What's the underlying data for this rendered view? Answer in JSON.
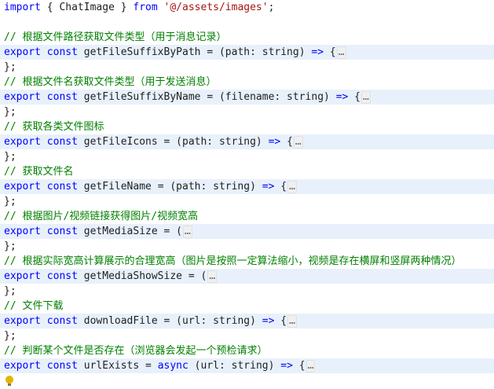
{
  "lines": [
    {
      "type": "import",
      "kw": "import",
      "open": "{",
      "name": "ChatImage",
      "close": "}",
      "from": "from",
      "path": "'@/assets/images'",
      "semi": ";"
    },
    {
      "type": "blank"
    },
    {
      "type": "comment",
      "text": "// 根据文件路径获取文件类型（用于消息记录）"
    },
    {
      "type": "fn",
      "export": "export",
      "const": "const",
      "name": "getFileSuffixByPath",
      "eq": "=",
      "params": "(path: string)",
      "arrow": "=>",
      "brace": "{",
      "ellipsis": "…"
    },
    {
      "type": "close",
      "text": "};"
    },
    {
      "type": "comment",
      "text": "// 根据文件名获取文件类型（用于发送消息）"
    },
    {
      "type": "fn",
      "export": "export",
      "const": "const",
      "name": "getFileSuffixByName",
      "eq": "=",
      "params": "(filename: string)",
      "arrow": "=>",
      "brace": "{",
      "ellipsis": "…"
    },
    {
      "type": "close",
      "text": "};"
    },
    {
      "type": "comment",
      "text": "// 获取各类文件图标"
    },
    {
      "type": "fn",
      "export": "export",
      "const": "const",
      "name": "getFileIcons",
      "eq": "=",
      "params": "(path: string)",
      "arrow": "=>",
      "brace": "{",
      "ellipsis": "…"
    },
    {
      "type": "close",
      "text": "};"
    },
    {
      "type": "comment",
      "text": "// 获取文件名"
    },
    {
      "type": "fn",
      "export": "export",
      "const": "const",
      "name": "getFileName",
      "eq": "=",
      "params": "(path: string)",
      "arrow": "=>",
      "brace": "{",
      "ellipsis": "…"
    },
    {
      "type": "close",
      "text": "};"
    },
    {
      "type": "comment",
      "text": "// 根据图片/视频链接获得图片/视频宽高"
    },
    {
      "type": "fnparen",
      "export": "export",
      "const": "const",
      "name": "getMediaSize",
      "eq": "=",
      "open": "(",
      "ellipsis": "…"
    },
    {
      "type": "close",
      "text": "};"
    },
    {
      "type": "comment",
      "text": "// 根据实际宽高计算展示的合理宽高（图片是按照一定算法缩小，视频是存在横屏和竖屏两种情况）"
    },
    {
      "type": "fnparen",
      "export": "export",
      "const": "const",
      "name": "getMediaShowSize",
      "eq": "=",
      "open": "(",
      "ellipsis": "…"
    },
    {
      "type": "close",
      "text": "};"
    },
    {
      "type": "comment",
      "text": "// 文件下载"
    },
    {
      "type": "fn",
      "export": "export",
      "const": "const",
      "name": "downloadFile",
      "eq": "=",
      "params": "(url: string)",
      "arrow": "=>",
      "brace": "{",
      "ellipsis": "…"
    },
    {
      "type": "close",
      "text": "};"
    },
    {
      "type": "comment",
      "text": "// 判断某个文件是否存在（浏览器会发起一个预检请求）"
    },
    {
      "type": "fnasync",
      "export": "export",
      "const": "const",
      "name": "urlExists",
      "eq": "=",
      "async": "async",
      "params": "(url: string)",
      "arrow": "=>",
      "brace": "{",
      "ellipsis": "…"
    },
    {
      "type": "bulb",
      "icon": "lightbulb-icon"
    }
  ]
}
